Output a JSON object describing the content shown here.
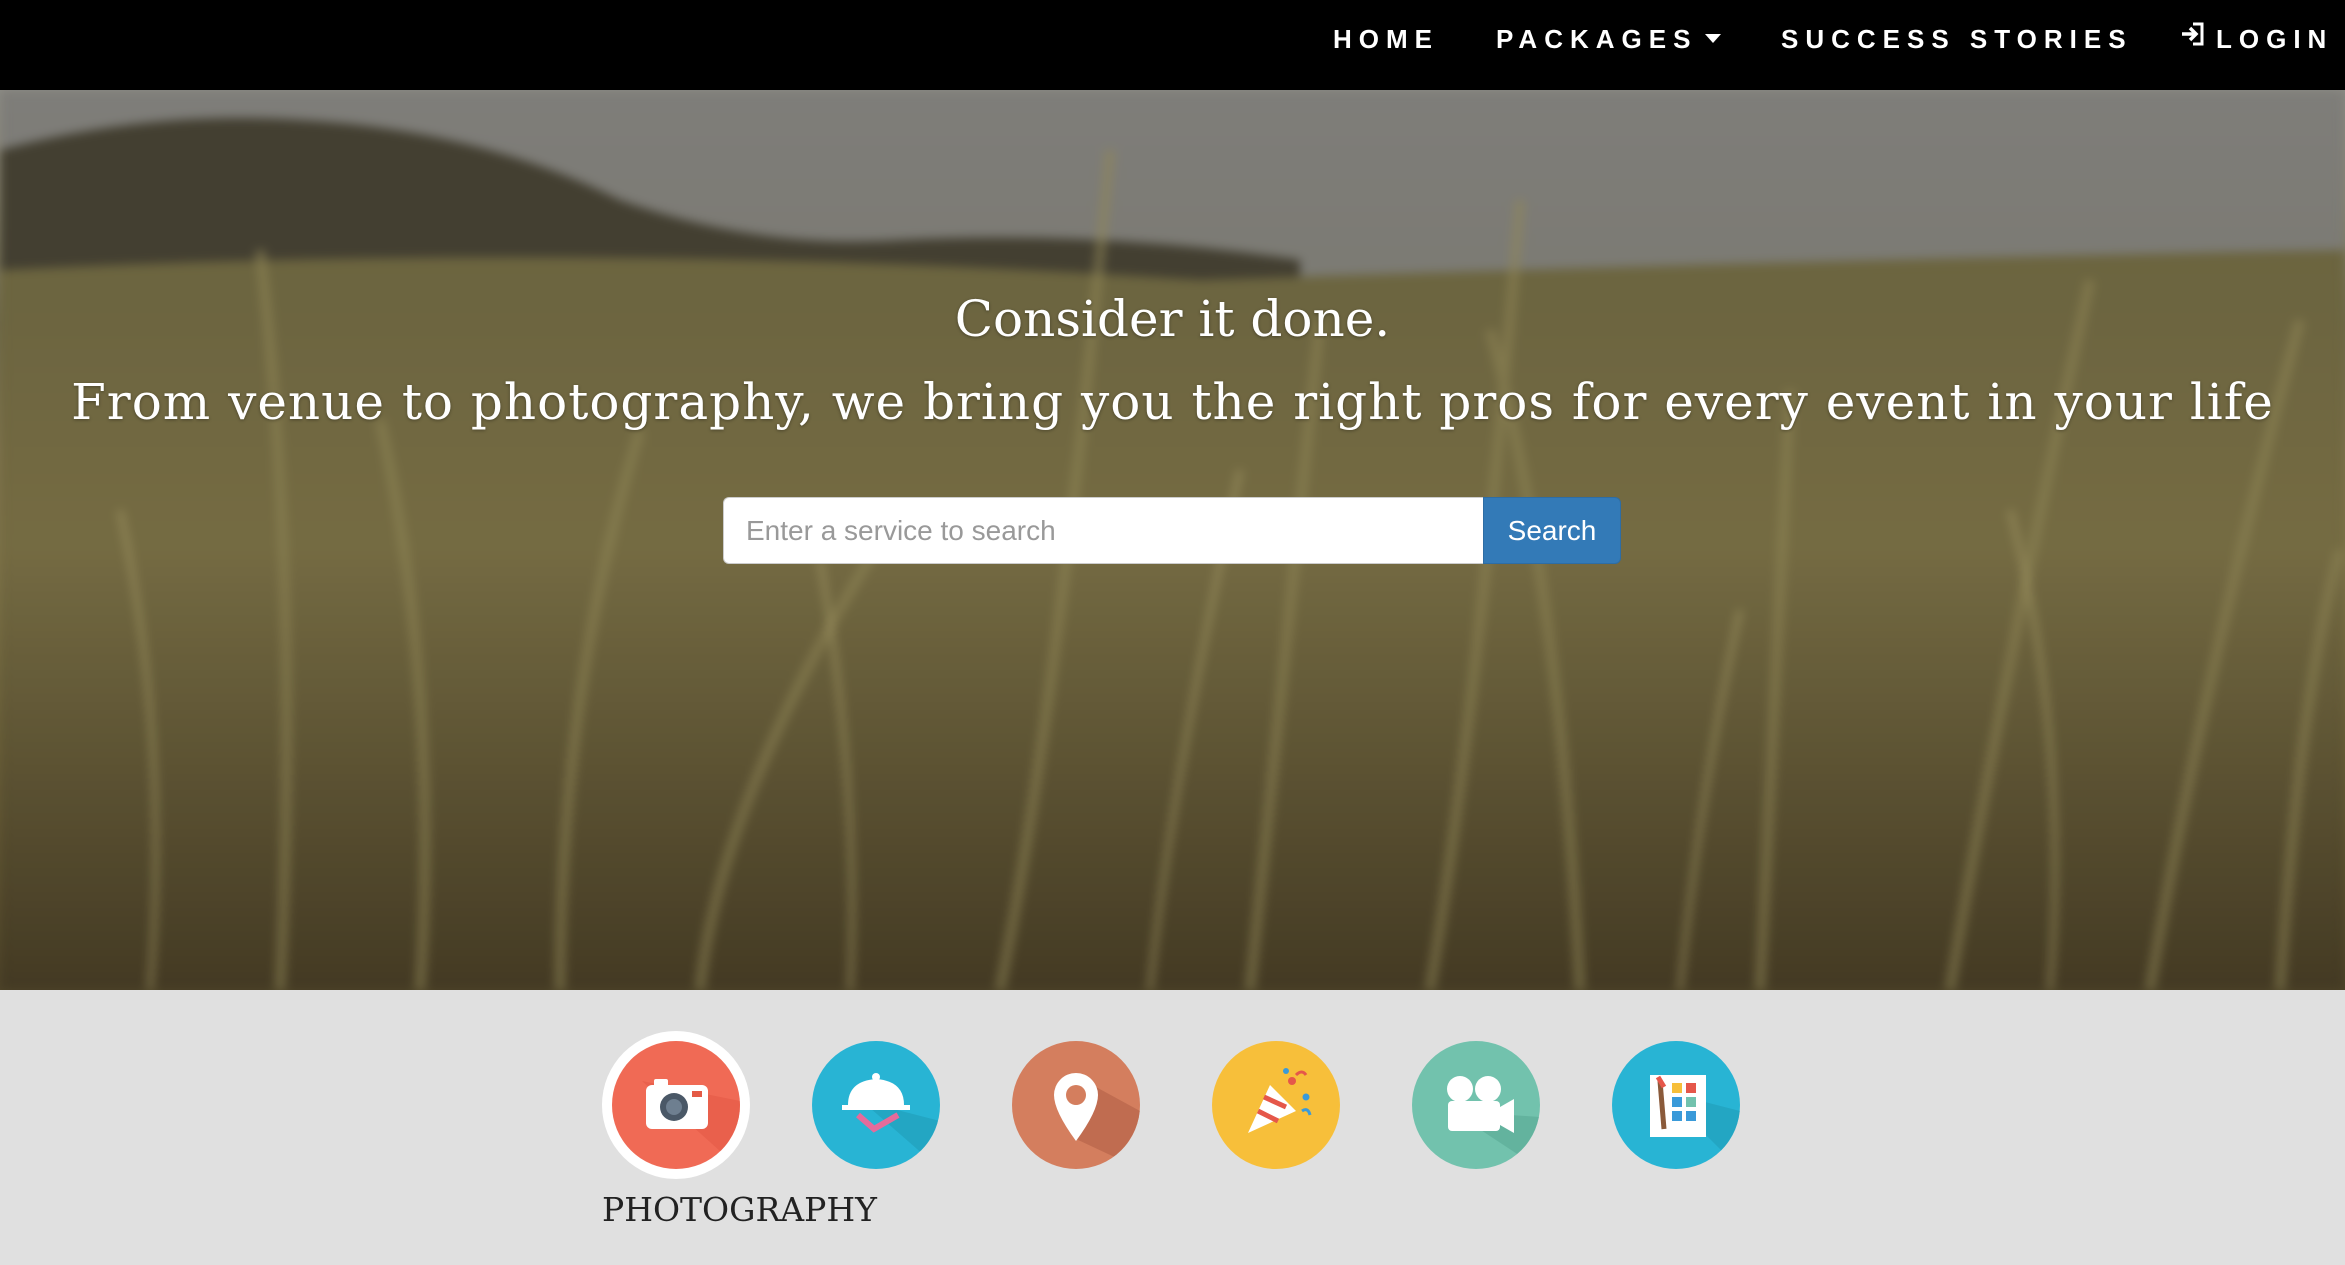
{
  "nav": {
    "home": "HOME",
    "packages": "PACKAGES",
    "success_stories": "SUCCESS STORIES",
    "login": "LOGIN"
  },
  "hero": {
    "line1": "Consider it done.",
    "line2": "From venue to photography, we bring you the right pros for every event in your life"
  },
  "search": {
    "placeholder": "Enter a service to search",
    "button_label": "Search"
  },
  "services": {
    "items": [
      {
        "icon": "camera-icon",
        "label": "PHOTOGRAPHY",
        "color": "#f06a55",
        "selected": true
      },
      {
        "icon": "cloche-icon",
        "color": "#28b4d4"
      },
      {
        "icon": "map-pin-icon",
        "color": "#d47e5e"
      },
      {
        "icon": "party-popper-icon",
        "color": "#f7bf3a"
      },
      {
        "icon": "video-camera-icon",
        "color": "#72c2ad"
      },
      {
        "icon": "palette-icon",
        "color": "#28b4d4"
      }
    ],
    "selected_label": "PHOTOGRAPHY"
  },
  "colors": {
    "nav_bg": "#000000",
    "search_button": "#337ab7",
    "services_bg": "#e0e0e0"
  }
}
